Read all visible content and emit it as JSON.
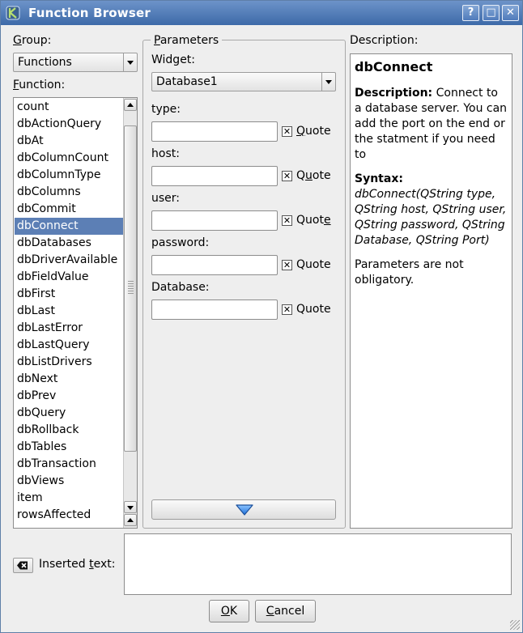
{
  "window": {
    "title": "Function Browser",
    "help_button": "?",
    "maximize_button": "□",
    "close_button": "✕"
  },
  "group": {
    "label_u": "G",
    "label_rest": "roup:",
    "selected": "Functions"
  },
  "function": {
    "label_u": "F",
    "label_rest": "unction:",
    "items": [
      "count",
      "dbActionQuery",
      "dbAt",
      "dbColumnCount",
      "dbColumnType",
      "dbColumns",
      "dbCommit",
      "dbConnect",
      "dbDatabases",
      "dbDriverAvailable",
      "dbFieldValue",
      "dbFirst",
      "dbLast",
      "dbLastError",
      "dbLastQuery",
      "dbListDrivers",
      "dbNext",
      "dbPrev",
      "dbQuery",
      "dbRollback",
      "dbTables",
      "dbTransaction",
      "dbViews",
      "item",
      "rowsAffected"
    ],
    "selected_index": 7
  },
  "parameters": {
    "title_u": "P",
    "title_rest": "arameters",
    "widget_label": "Widget:",
    "widget_value": "Database1",
    "quote_label": "Quote",
    "fields": [
      {
        "label": "type:",
        "value": "",
        "quote_checked": true,
        "q_pre": "",
        "q_u": "Q",
        "q_post": "uote"
      },
      {
        "label": "host:",
        "value": "",
        "quote_checked": true,
        "q_pre": "Q",
        "q_u": "u",
        "q_post": "ote"
      },
      {
        "label": "user:",
        "value": "",
        "quote_checked": true,
        "q_pre": "Quot",
        "q_u": "e",
        "q_post": ""
      },
      {
        "label": "password:",
        "value": "",
        "quote_checked": true,
        "q_pre": "Quote",
        "q_u": "",
        "q_post": ""
      },
      {
        "label": "Database:",
        "value": "",
        "quote_checked": true,
        "q_pre": "Quote",
        "q_u": "",
        "q_post": ""
      }
    ]
  },
  "description": {
    "label": "Description:",
    "heading": "dbConnect",
    "desc_label": "Description:",
    "desc_text": " Connect to a database server. You can add the port on the end or the statment if you need to",
    "syntax_label": "Syntax:",
    "syntax": "dbConnect(QString type, QString host, QString user, QString password, QString Database, QString Port)",
    "note": "Parameters are not obligatory."
  },
  "inserted": {
    "label_pre": "Inserted ",
    "label_u": "t",
    "label_post": "ext:",
    "value": ""
  },
  "buttons": {
    "ok_u": "O",
    "ok_rest": "K",
    "cancel_u": "C",
    "cancel_rest": "ancel"
  },
  "colors": {
    "titlebar": "#4f7bbb",
    "selection": "#5c7fb5",
    "arrow_button": "#2f7fe0"
  },
  "icons": {
    "app": "kommander-icon",
    "scroll_down": "blue-down-arrow-icon",
    "insert": "clear-text-icon"
  }
}
